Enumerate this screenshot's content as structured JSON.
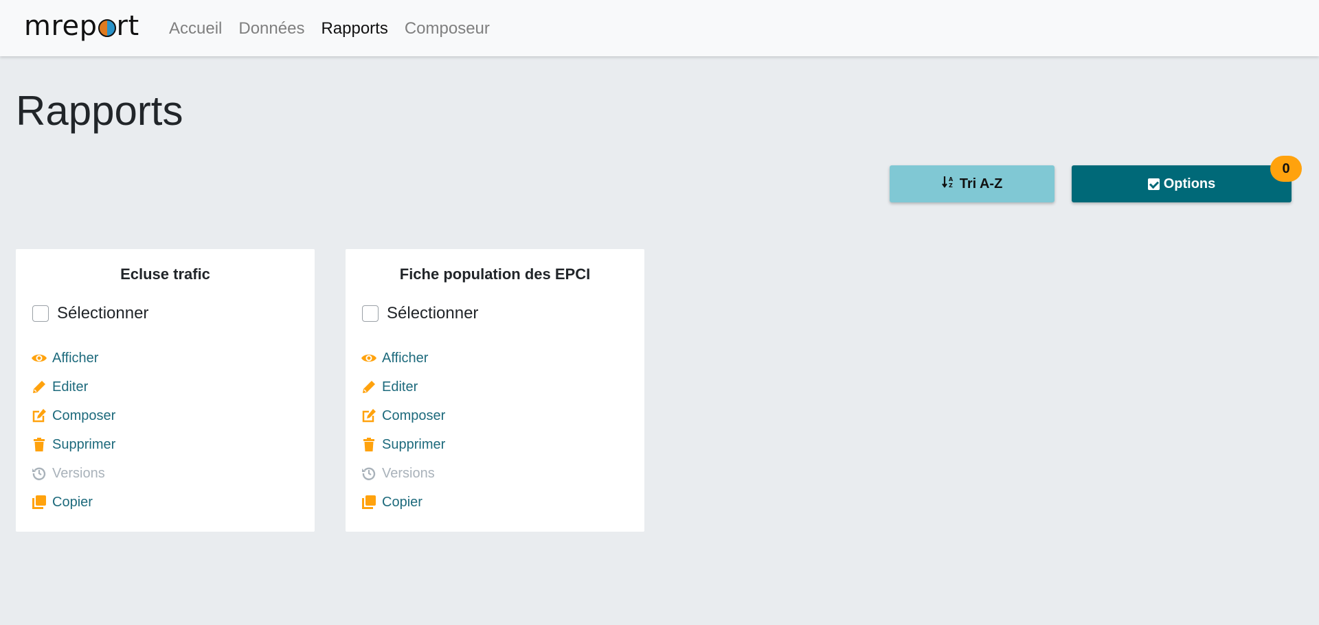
{
  "brand": {
    "prefix": "mrep",
    "suffix": "rt"
  },
  "nav": {
    "items": [
      {
        "label": "Accueil",
        "active": false
      },
      {
        "label": "Données",
        "active": false
      },
      {
        "label": "Rapports",
        "active": true
      },
      {
        "label": "Composeur",
        "active": false
      }
    ]
  },
  "page": {
    "title": "Rapports"
  },
  "toolbar": {
    "sort_label": "Tri A-Z",
    "options_label": "Options",
    "selected_count": "0"
  },
  "colors": {
    "accent_orange": "#ffa20d",
    "teal_dark": "#006978",
    "teal_light": "#80c8d4",
    "link": "#1d6a7c"
  },
  "reports": [
    {
      "title": "Ecluse trafic",
      "select_label": "Sélectionner",
      "actions": [
        {
          "label": "Afficher",
          "icon": "eye-icon"
        },
        {
          "label": "Editer",
          "icon": "pencil-icon"
        },
        {
          "label": "Composer",
          "icon": "edit-square-icon"
        },
        {
          "label": "Supprimer",
          "icon": "trash-icon"
        },
        {
          "label": "Versions",
          "icon": "history-icon",
          "disabled": true
        },
        {
          "label": "Copier",
          "icon": "copy-icon"
        }
      ]
    },
    {
      "title": "Fiche population des EPCI",
      "select_label": "Sélectionner",
      "actions": [
        {
          "label": "Afficher",
          "icon": "eye-icon"
        },
        {
          "label": "Editer",
          "icon": "pencil-icon"
        },
        {
          "label": "Composer",
          "icon": "edit-square-icon"
        },
        {
          "label": "Supprimer",
          "icon": "trash-icon"
        },
        {
          "label": "Versions",
          "icon": "history-icon",
          "disabled": true
        },
        {
          "label": "Copier",
          "icon": "copy-icon"
        }
      ]
    }
  ]
}
